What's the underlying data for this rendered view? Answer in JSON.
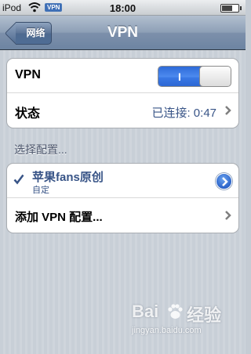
{
  "status_bar": {
    "carrier": "iPod",
    "vpn_badge": "VPN",
    "time": "18:00"
  },
  "nav": {
    "back_label": "网络",
    "title": "VPN"
  },
  "vpn_group": {
    "toggle_row": {
      "label": "VPN",
      "toggle_on_text": "I",
      "toggle_state": "on"
    },
    "status_row": {
      "label": "状态",
      "value": "已连接: 0:47"
    }
  },
  "config_section": {
    "header": "选择配置...",
    "profiles": [
      {
        "name": "苹果fans原创",
        "subtitle": "自定",
        "selected": true
      }
    ],
    "add_label": "添加 VPN 配置..."
  },
  "watermark": {
    "brand_left": "Bai",
    "brand_right": "经验",
    "url": "jingyan.baidu.com"
  },
  "colors": {
    "accent_blue": "#385487",
    "toggle_blue": "#3a79e6",
    "navbar": "#6d84a2"
  }
}
